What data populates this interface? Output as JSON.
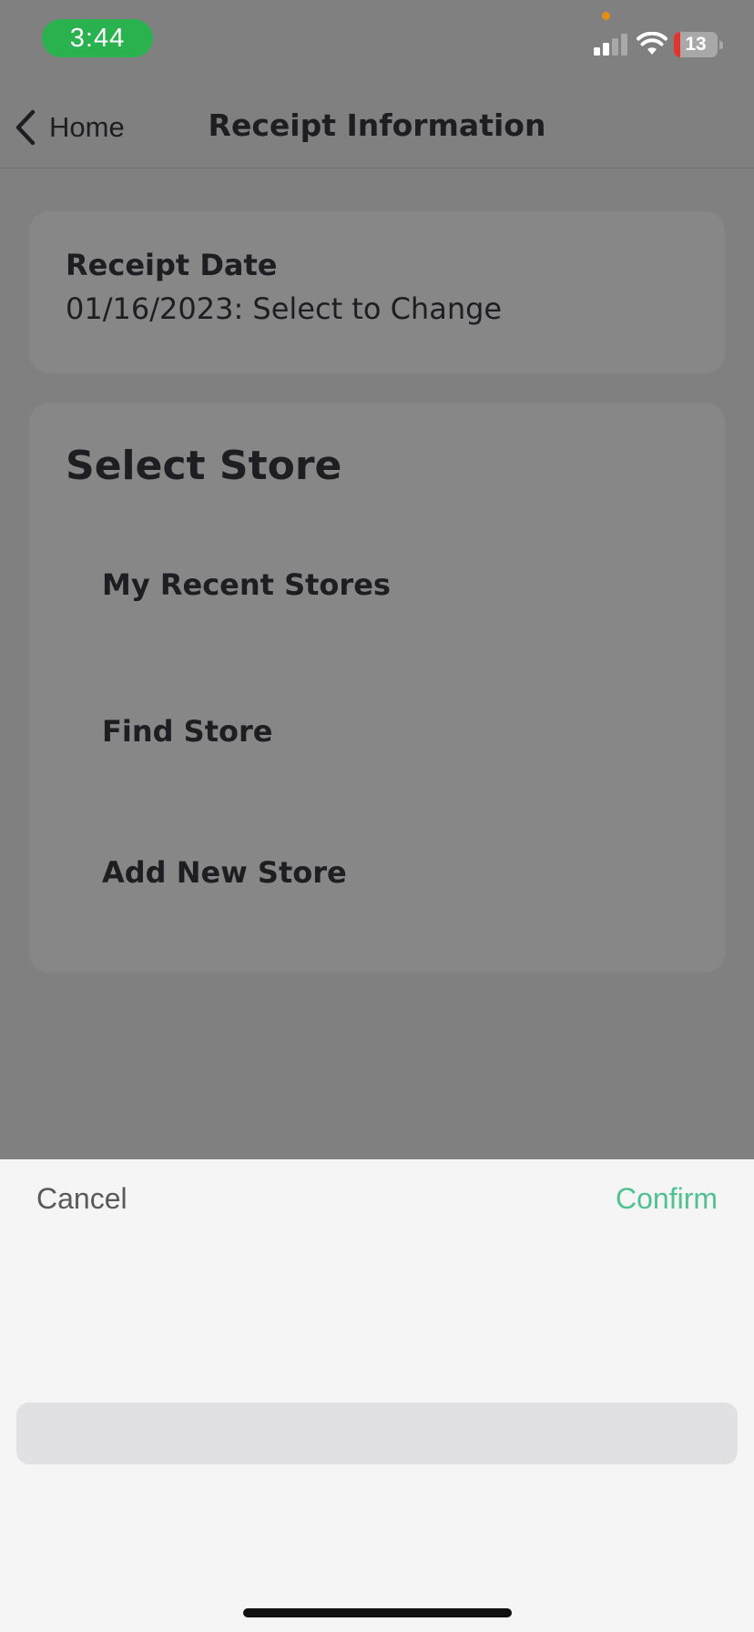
{
  "status_bar": {
    "time": "3:44",
    "battery_level": "13",
    "icons": [
      "cellular-signal-icon",
      "wifi-icon",
      "battery-icon"
    ],
    "colors": {
      "time_pill": "#2ab24f",
      "privacy_dot": "#e58d17",
      "battery_low": "#e2332d"
    }
  },
  "nav": {
    "back_label": "Home",
    "back_icon": "chevron-left-icon",
    "title": "Receipt Information"
  },
  "receipt_date": {
    "heading": "Receipt Date",
    "value": "01/16/2023: Select to Change"
  },
  "select_store": {
    "heading": "Select Store",
    "options": [
      {
        "label": "My Recent Stores"
      },
      {
        "label": "Find Store"
      },
      {
        "label": "Add New Store"
      }
    ]
  },
  "picker_sheet": {
    "cancel_label": "Cancel",
    "confirm_label": "Confirm",
    "confirm_color": "#4fc291"
  }
}
